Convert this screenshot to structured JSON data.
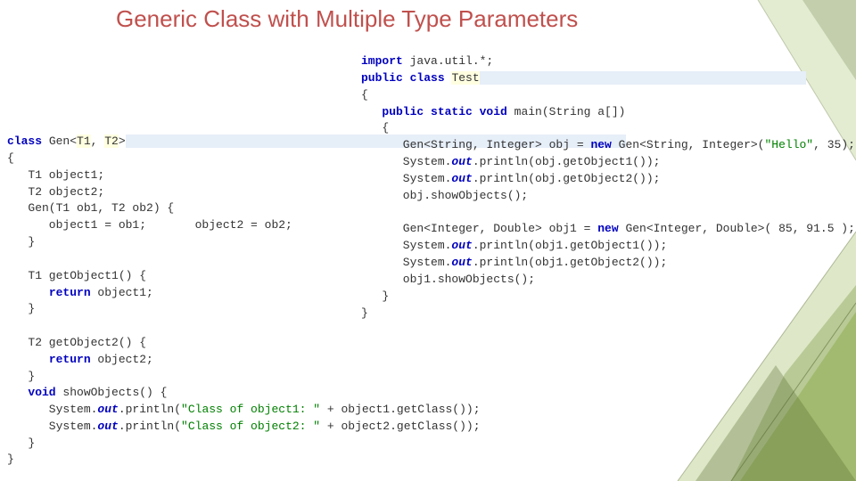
{
  "title": "Generic Class with Multiple Type Parameters",
  "code_left_top": "<span class='kw'>class</span> Gen&lt;<span class='hlY'>T1</span>, <span class='hlY'>T2</span>&gt;<span class='hl'>                                                                        </span>\n{\n   T1 object1;\n   T2 object2;\n   Gen(T1 ob1, T2 ob2) {\n      object1 = ob1;       object2 = ob2;\n   }\n\n   T1 getObject1() {\n      <span class='kw'>return</span> object1;\n   }\n\n   T2 getObject2() {\n      <span class='kw'>return</span> object2;\n   }",
  "code_left_bottom": "   <span class='kw'>void</span> showObjects() {\n      System.<span class='fldI boldmono'>out</span>.println(<span class='str'>\"Class of object1: \"</span> + object1.getClass());\n      System.<span class='fldI boldmono'>out</span>.println(<span class='str'>\"Class of object2: \"</span> + object2.getClass());\n   }\n}",
  "code_right": "<span class='kw'>import</span> java.util.*;\n<span class='kw'>public class</span> <span class='hlY'>Test</span><span class='hl'>                                               </span>\n{\n   <span class='kw'>public static void</span> main(String a[])\n   {\n      Gen&lt;String, Integer&gt; obj = <span class='kw'>new</span> Gen&lt;String, Integer&gt;(<span class='str'>\"Hello\"</span>, 35);\n      System.<span class='fldI boldmono'>out</span>.println(obj.getObject1());\n      System.<span class='fldI boldmono'>out</span>.println(obj.getObject2());\n      obj.showObjects();\n\n      Gen&lt;Integer, Double&gt; obj1 = <span class='kw'>new</span> Gen&lt;Integer, Double&gt;( 85, 91.5 );\n      System.<span class='fldI boldmono'>out</span>.println(obj1.getObject1());\n      System.<span class='fldI boldmono'>out</span>.println(obj1.getObject2());\n      obj1.showObjects();\n   }\n}"
}
